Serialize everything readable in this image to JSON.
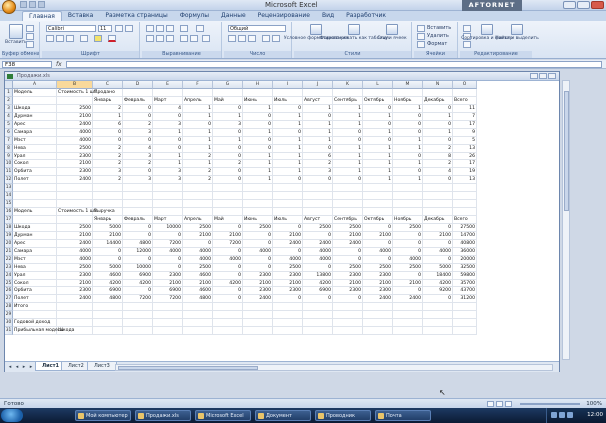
{
  "app": {
    "title": "Microsoft Excel",
    "logo_text": "AFTORNET"
  },
  "ribbon": {
    "tabs": [
      "Главная",
      "Вставка",
      "Разметка страницы",
      "Формулы",
      "Данные",
      "Рецензирование",
      "Вид",
      "Разработчик"
    ],
    "active_tab": 0,
    "paste_label": "Вставить",
    "font_name": "Calibri",
    "font_size": "11",
    "number_format": "Общий",
    "cond_format_label": "Условное форматирование",
    "format_table_label": "Форматировать как таблицу",
    "cell_styles_label": "Стили ячеек",
    "insert_label": "Вставить",
    "delete_label": "Удалить",
    "format_label": "Формат",
    "sort_label": "Сортировка и фильтр",
    "find_label": "Найти и выделить",
    "groups": {
      "clipboard": "Буфер обмена",
      "font": "Шрифт",
      "alignment": "Выравнивание",
      "number": "Число",
      "styles": "Стили",
      "cells": "Ячейки",
      "editing": "Редактирование"
    }
  },
  "formula_bar": {
    "name_box": "F38",
    "fx": "fx"
  },
  "workbook": {
    "title": "Продажи.xls",
    "columns": [
      "A",
      "B",
      "C",
      "D",
      "E",
      "F",
      "G",
      "H",
      "I",
      "J",
      "K",
      "L",
      "M",
      "N",
      "O"
    ],
    "selected_column": "B",
    "rows": [
      [
        "Модель",
        "Стоимость 1 шт.",
        "Продано",
        "",
        "",
        "",
        "",
        "",
        "",
        "",
        "",
        "",
        "",
        "",
        ""
      ],
      [
        "",
        "",
        "Январь",
        "Февраль",
        "Март",
        "Апрель",
        "Май",
        "Июнь",
        "Июль",
        "Август",
        "Сентябрь",
        "Октябрь",
        "Ноябрь",
        "Декабрь",
        "Всего"
      ],
      [
        "Шкода",
        "2500",
        "2",
        "0",
        "4",
        "1",
        "0",
        "1",
        "0",
        "1",
        "1",
        "0",
        "1",
        "0",
        "11"
      ],
      [
        "Дурман",
        "2100",
        "1",
        "0",
        "0",
        "1",
        "1",
        "0",
        "1",
        "0",
        "1",
        "1",
        "0",
        "1",
        "7"
      ],
      [
        "Арес",
        "2400",
        "6",
        "2",
        "3",
        "0",
        "3",
        "0",
        "1",
        "1",
        "1",
        "0",
        "0",
        "0",
        "17"
      ],
      [
        "Самара",
        "4000",
        "0",
        "3",
        "1",
        "1",
        "0",
        "1",
        "0",
        "1",
        "0",
        "1",
        "0",
        "1",
        "9"
      ],
      [
        "Мэст",
        "4000",
        "0",
        "0",
        "0",
        "1",
        "1",
        "0",
        "1",
        "1",
        "0",
        "0",
        "1",
        "0",
        "5"
      ],
      [
        "Нева",
        "2500",
        "2",
        "4",
        "0",
        "1",
        "0",
        "0",
        "1",
        "0",
        "1",
        "1",
        "1",
        "2",
        "13"
      ],
      [
        "Урал",
        "2300",
        "2",
        "3",
        "1",
        "2",
        "0",
        "1",
        "1",
        "6",
        "1",
        "1",
        "0",
        "8",
        "26"
      ],
      [
        "Сокол",
        "2100",
        "2",
        "2",
        "1",
        "1",
        "2",
        "1",
        "1",
        "2",
        "1",
        "1",
        "1",
        "2",
        "17"
      ],
      [
        "Орбита",
        "2300",
        "3",
        "0",
        "3",
        "2",
        "0",
        "1",
        "1",
        "3",
        "1",
        "1",
        "0",
        "4",
        "19"
      ],
      [
        "Полет",
        "2400",
        "2",
        "3",
        "3",
        "2",
        "0",
        "1",
        "0",
        "0",
        "0",
        "1",
        "1",
        "0",
        "13"
      ],
      [
        "",
        "",
        "",
        "",
        "",
        "",
        "",
        "",
        "",
        "",
        "",
        "",
        "",
        "",
        ""
      ],
      [
        "",
        "",
        "",
        "",
        "",
        "",
        "",
        "",
        "",
        "",
        "",
        "",
        "",
        "",
        ""
      ],
      [
        "",
        "",
        "",
        "",
        "",
        "",
        "",
        "",
        "",
        "",
        "",
        "",
        "",
        "",
        ""
      ],
      [
        "Модель",
        "Стоимость 1 шт.",
        "Выручка",
        "",
        "",
        "",
        "",
        "",
        "",
        "",
        "",
        "",
        "",
        "",
        ""
      ],
      [
        "",
        "",
        "Январь",
        "Февраль",
        "Март",
        "Апрель",
        "Май",
        "Июнь",
        "Июль",
        "Август",
        "Сентябрь",
        "Октябрь",
        "Ноябрь",
        "Декабрь",
        "Всего"
      ],
      [
        "Шкода",
        "2500",
        "5000",
        "0",
        "10000",
        "2500",
        "0",
        "2500",
        "0",
        "2500",
        "2500",
        "0",
        "2500",
        "0",
        "27500"
      ],
      [
        "Дурман",
        "2100",
        "2100",
        "0",
        "0",
        "2100",
        "2100",
        "0",
        "2100",
        "0",
        "2100",
        "2100",
        "0",
        "2100",
        "14700"
      ],
      [
        "Арес",
        "2400",
        "14400",
        "4800",
        "7200",
        "0",
        "7200",
        "0",
        "2400",
        "2400",
        "2400",
        "0",
        "0",
        "0",
        "40800"
      ],
      [
        "Самара",
        "4000",
        "0",
        "12000",
        "4000",
        "4000",
        "0",
        "4000",
        "0",
        "4000",
        "0",
        "4000",
        "0",
        "4000",
        "36000"
      ],
      [
        "Мэст",
        "4000",
        "0",
        "0",
        "0",
        "4000",
        "4000",
        "0",
        "4000",
        "4000",
        "0",
        "0",
        "4000",
        "0",
        "20000"
      ],
      [
        "Нева",
        "2500",
        "5000",
        "10000",
        "0",
        "2500",
        "0",
        "0",
        "2500",
        "0",
        "2500",
        "2500",
        "2500",
        "5000",
        "32500"
      ],
      [
        "Урал",
        "2300",
        "4600",
        "6900",
        "2300",
        "4600",
        "0",
        "2300",
        "2300",
        "13800",
        "2300",
        "2300",
        "0",
        "18400",
        "59800"
      ],
      [
        "Сокол",
        "2100",
        "4200",
        "4200",
        "2100",
        "2100",
        "4200",
        "2100",
        "2100",
        "4200",
        "2100",
        "2100",
        "2100",
        "4200",
        "35700"
      ],
      [
        "Орбита",
        "2300",
        "6900",
        "0",
        "6900",
        "4600",
        "0",
        "2300",
        "2300",
        "6900",
        "2300",
        "2300",
        "0",
        "9200",
        "43700"
      ],
      [
        "Полет",
        "2400",
        "4800",
        "7200",
        "7200",
        "4800",
        "0",
        "2400",
        "0",
        "0",
        "0",
        "2400",
        "2400",
        "0",
        "31200"
      ],
      [
        "Итого",
        "",
        "",
        "",
        "",
        "",
        "",
        "",
        "",
        "",
        "",
        "",
        "",
        "",
        ""
      ],
      [
        "",
        "",
        "",
        "",
        "",
        "",
        "",
        "",
        "",
        "",
        "",
        "",
        "",
        "",
        ""
      ],
      [
        "Годовой доход",
        "",
        "",
        "",
        "",
        "",
        "",
        "",
        "",
        "",
        "",
        "",
        "",
        "",
        ""
      ],
      [
        "Прибыльная модель",
        "Шкода",
        "",
        "",
        "",
        "",
        "",
        "",
        "",
        "",
        "",
        "",
        "",
        "",
        ""
      ]
    ],
    "sheet_tabs": [
      "Лист1",
      "Лист2",
      "Лист3"
    ],
    "active_sheet": 0
  },
  "status": {
    "text": "Готово",
    "zoom": "100%"
  },
  "taskbar": {
    "items": [
      "Пуск",
      "Мой компьютер",
      "Продажи.xls",
      "Microsoft Excel",
      "Документ",
      "Проводник",
      "Почта"
    ],
    "clock": "12:00"
  }
}
